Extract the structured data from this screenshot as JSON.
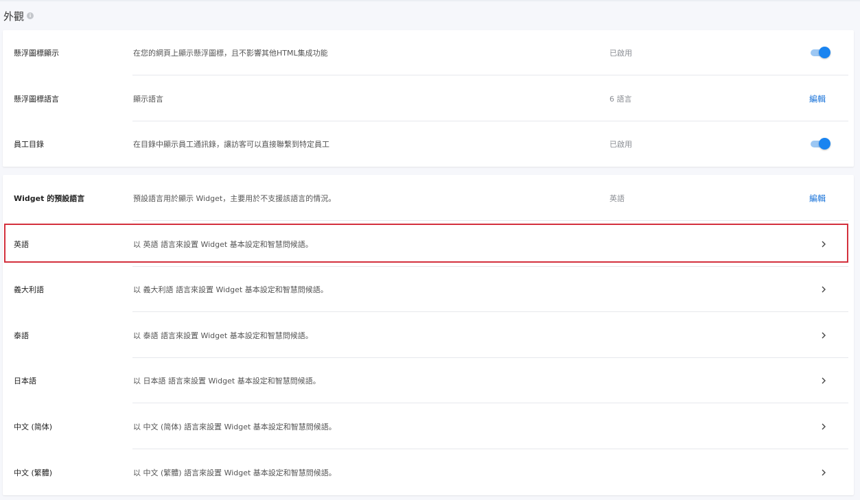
{
  "section": {
    "title": "外觀",
    "info_icon": "info-icon"
  },
  "card1": {
    "rows": [
      {
        "label": "懸浮圖標顯示",
        "desc": "在您的網頁上顯示懸浮圖標，且不影響其他HTML集成功能",
        "status": "已啟用",
        "control": "toggle",
        "enabled": true
      },
      {
        "label": "懸浮圖標語言",
        "desc": "顯示語言",
        "status": "6 語言",
        "control": "edit",
        "edit_label": "編輯"
      },
      {
        "label": "員工目錄",
        "desc": "在目錄中顯示員工通訊錄，讓訪客可以直接聯繫到特定員工",
        "status": "已啟用",
        "control": "toggle",
        "enabled": true
      }
    ]
  },
  "card2": {
    "default_language": {
      "label": "Widget 的預設語言",
      "desc": "預設語言用於顯示 Widget，主要用於不支援該語言的情況。",
      "status": "英語",
      "edit_label": "編輯"
    },
    "languages": [
      {
        "label": "英語",
        "desc": "以 英語 語言來設置 Widget 基本設定和智慧問候語。"
      },
      {
        "label": "義大利語",
        "desc": "以 義大利語 語言來設置 Widget 基本設定和智慧問候語。"
      },
      {
        "label": "泰語",
        "desc": "以 泰語 語言來設置 Widget 基本設定和智慧問候語。"
      },
      {
        "label": "日本語",
        "desc": "以 日本語 語言來設置 Widget 基本設定和智慧問候語。"
      },
      {
        "label": "中文 (简体)",
        "desc": "以 中文 (简体) 語言來設置 Widget 基本設定和智慧問候語。"
      },
      {
        "label": "中文 (繁體)",
        "desc": "以 中文 (繁體) 語言來設置 Widget 基本設定和智慧問候語。"
      }
    ]
  },
  "colors": {
    "accent": "#1a84f0",
    "link": "#1a73d9",
    "highlight": "#d32f3c"
  }
}
